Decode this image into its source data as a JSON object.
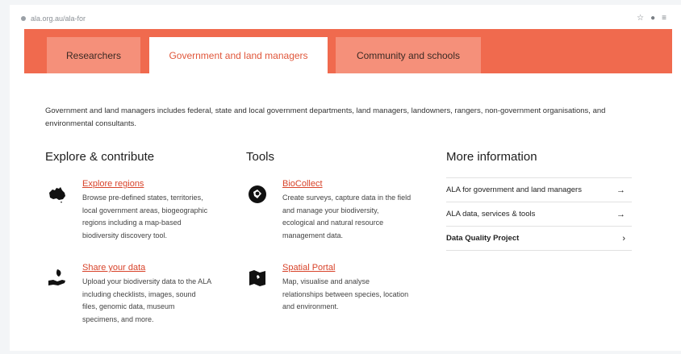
{
  "browser": {
    "url": "ala.org.au/ala-for"
  },
  "tabs": [
    {
      "label": "Researchers"
    },
    {
      "label": "Government and land managers"
    },
    {
      "label": "Community and schools"
    }
  ],
  "intro": "Government and land managers includes federal, state and local government departments, land managers, landowners, rangers, non-government organisations, and environmental consultants.",
  "columns": {
    "explore": "Explore & contribute",
    "tools": "Tools",
    "more": "More information"
  },
  "cards": [
    {
      "title": "Explore regions",
      "desc": "Browse pre-defined states, territories, local government areas, biogeographic regions including a map-based biodiversity discovery tool.",
      "icon": "australia-map-icon"
    },
    {
      "title": "Share your data",
      "desc": "Upload your biodiversity data to the ALA including checklists, images, sound files, genomic data, museum specimens, and more.",
      "icon": "hand-leaf-icon"
    },
    {
      "title": "BioCollect",
      "desc": "Create surveys, capture data in the field and manage your biodiversity, ecological and natural resource management data.",
      "icon": "biocollect-icon"
    },
    {
      "title": "Spatial Portal",
      "desc": "Map, visualise and analyse relationships between species, location and environment.",
      "icon": "spatial-map-icon"
    }
  ],
  "more_links": [
    {
      "label": "ALA for government and land managers",
      "arrow": "→"
    },
    {
      "label": "ALA data, services & tools",
      "arrow": "→"
    },
    {
      "label": "Data Quality Project",
      "arrow": "›"
    }
  ],
  "colors": {
    "accent": "#f06a4e",
    "link": "#d8432a"
  }
}
